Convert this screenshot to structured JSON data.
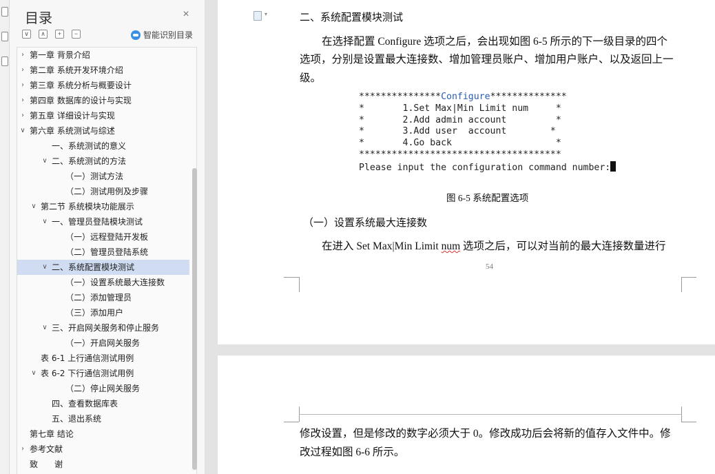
{
  "toc": {
    "title": "目录",
    "close_glyph": "×",
    "controls": [
      "∨",
      "∧",
      "+",
      "−"
    ],
    "ai_label": "智能识别目录",
    "ai_icon": "cloud-icon",
    "items": [
      {
        "text": "第一章 背景介绍",
        "level": 0,
        "chev": "›"
      },
      {
        "text": "第二章 系统开发环境介绍",
        "level": 0,
        "chev": "›"
      },
      {
        "text": "第三章 系统分析与概要设计",
        "level": 0,
        "chev": "›"
      },
      {
        "text": "第四章 数据库的设计与实现",
        "level": 0,
        "chev": "›"
      },
      {
        "text": "第五章 详细设计与实现",
        "level": 0,
        "chev": "›"
      },
      {
        "text": "第六章 系统测试与综述",
        "level": 0,
        "chev": "∨"
      },
      {
        "text": "一、系统测试的意义",
        "level": 2,
        "chev": ""
      },
      {
        "text": "二、系统测试的方法",
        "level": 2,
        "chev": "∨"
      },
      {
        "text": "（一）测试方法",
        "level": 3,
        "chev": ""
      },
      {
        "text": "（二）测试用例及步骤",
        "level": 3,
        "chev": ""
      },
      {
        "text": "第二节 系统模块功能展示",
        "level": 1,
        "chev": "∨"
      },
      {
        "text": "一、管理员登陆模块测试",
        "level": 2,
        "chev": "∨"
      },
      {
        "text": "（一）远程登陆开发板",
        "level": 3,
        "chev": ""
      },
      {
        "text": "（二）管理员登陆系统",
        "level": 3,
        "chev": ""
      },
      {
        "text": "二、系统配置模块测试",
        "level": 2,
        "chev": "∨",
        "selected": true
      },
      {
        "text": "（一）设置系统最大连接数",
        "level": 3,
        "chev": ""
      },
      {
        "text": "（二）添加管理员",
        "level": 3,
        "chev": ""
      },
      {
        "text": "（三）添加用户",
        "level": 3,
        "chev": ""
      },
      {
        "text": "三、开启网关服务和停止服务",
        "level": 2,
        "chev": "∨"
      },
      {
        "text": "（一）开启网关服务",
        "level": 3,
        "chev": ""
      },
      {
        "text": "表 6-1 上行通信测试用例",
        "level": 1,
        "chev": ""
      },
      {
        "text": "表 6-2 下行通信测试用例",
        "level": 1,
        "chev": "∨"
      },
      {
        "text": "（二）停止网关服务",
        "level": 3,
        "chev": ""
      },
      {
        "text": "四、查看数据库表",
        "level": 2,
        "chev": ""
      },
      {
        "text": "五、退出系统",
        "level": 2,
        "chev": ""
      },
      {
        "text": "第七章 结论",
        "level": 0,
        "chev": ""
      },
      {
        "text": "参考文献",
        "level": 0,
        "chev": "›"
      },
      {
        "text": "致　　谢",
        "level": 0,
        "chev": ""
      }
    ]
  },
  "doc": {
    "heading": "二、系统配置模块测试",
    "para1_line1": "在选择配置 Configure 选项之后，会出现如图 6-5 所示的下一级目录的四个",
    "para1_line2": "选项，分别是设置最大连接数、增加管理员账户、增加用户账户、以及返回上一",
    "para1_line3": "级。",
    "console": {
      "line1_a": "***************",
      "line1_b": "Configure",
      "line1_c": "**************",
      "line2": "*       1.Set Max|Min Limit num     *",
      "line3": "*       2.Add admin account         *",
      "line4": "*       3.Add user  account        *",
      "line5": "*       4.Go back                   *",
      "line6": "*************************************",
      "line7": "Please input the configuration command number:"
    },
    "figure_caption": "图 6-5  系统配置选项",
    "subheading": "（一）设置系统最大连接数",
    "para2_a": "在进入 Set Max|Min Limit ",
    "para2_wavy": "num",
    "para2_b": " 选项之后，可以对当前的最大连接数量进行",
    "page_number": "54",
    "para3_line1": "修改设置，但是修改的数字必须大于 0。修改成功后会将新的值存入文件中。修",
    "para3_line2": "改过程如图 6-6 所示。"
  }
}
